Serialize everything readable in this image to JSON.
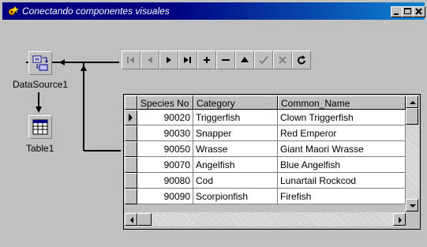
{
  "window": {
    "title": "Conectando componentes visuales",
    "minimize_icon": "minimize-icon",
    "maximize_icon": "maximize-icon",
    "close_icon": "close-icon"
  },
  "components": {
    "datasource": {
      "label": "DataSource1",
      "icon": "datasource-icon"
    },
    "table": {
      "label": "Table1",
      "icon": "table-icon"
    }
  },
  "navigator": {
    "buttons": [
      {
        "name": "first",
        "icon": "first-record-icon",
        "enabled": false
      },
      {
        "name": "prior",
        "icon": "prior-record-icon",
        "enabled": false
      },
      {
        "name": "next",
        "icon": "next-record-icon",
        "enabled": true
      },
      {
        "name": "last",
        "icon": "last-record-icon",
        "enabled": true
      },
      {
        "name": "insert",
        "icon": "insert-record-icon",
        "enabled": true
      },
      {
        "name": "delete",
        "icon": "delete-record-icon",
        "enabled": true
      },
      {
        "name": "edit",
        "icon": "edit-record-icon",
        "enabled": true
      },
      {
        "name": "post",
        "icon": "post-record-icon",
        "enabled": false
      },
      {
        "name": "cancel",
        "icon": "cancel-record-icon",
        "enabled": false
      },
      {
        "name": "refresh",
        "icon": "refresh-icon",
        "enabled": true
      }
    ]
  },
  "grid": {
    "columns": [
      "Species No",
      "Category",
      "Common_Name"
    ],
    "rows": [
      {
        "species_no": "90020",
        "category": "Triggerfish",
        "common_name": "Clown Triggerfish"
      },
      {
        "species_no": "90030",
        "category": "Snapper",
        "common_name": "Red Emperor"
      },
      {
        "species_no": "90050",
        "category": "Wrasse",
        "common_name": "Giant Maori Wrasse"
      },
      {
        "species_no": "90070",
        "category": "Angelfish",
        "common_name": "Blue Angelfish"
      },
      {
        "species_no": "90080",
        "category": "Cod",
        "common_name": "Lunartail Rockcod"
      },
      {
        "species_no": "90090",
        "category": "Scorpionfish",
        "common_name": "Firefish"
      }
    ],
    "current_row": 0
  },
  "colors": {
    "titlebar_start": "#000080",
    "titlebar_end": "#1084d0",
    "face": "#c0c0c0",
    "disabled": "#808080"
  }
}
